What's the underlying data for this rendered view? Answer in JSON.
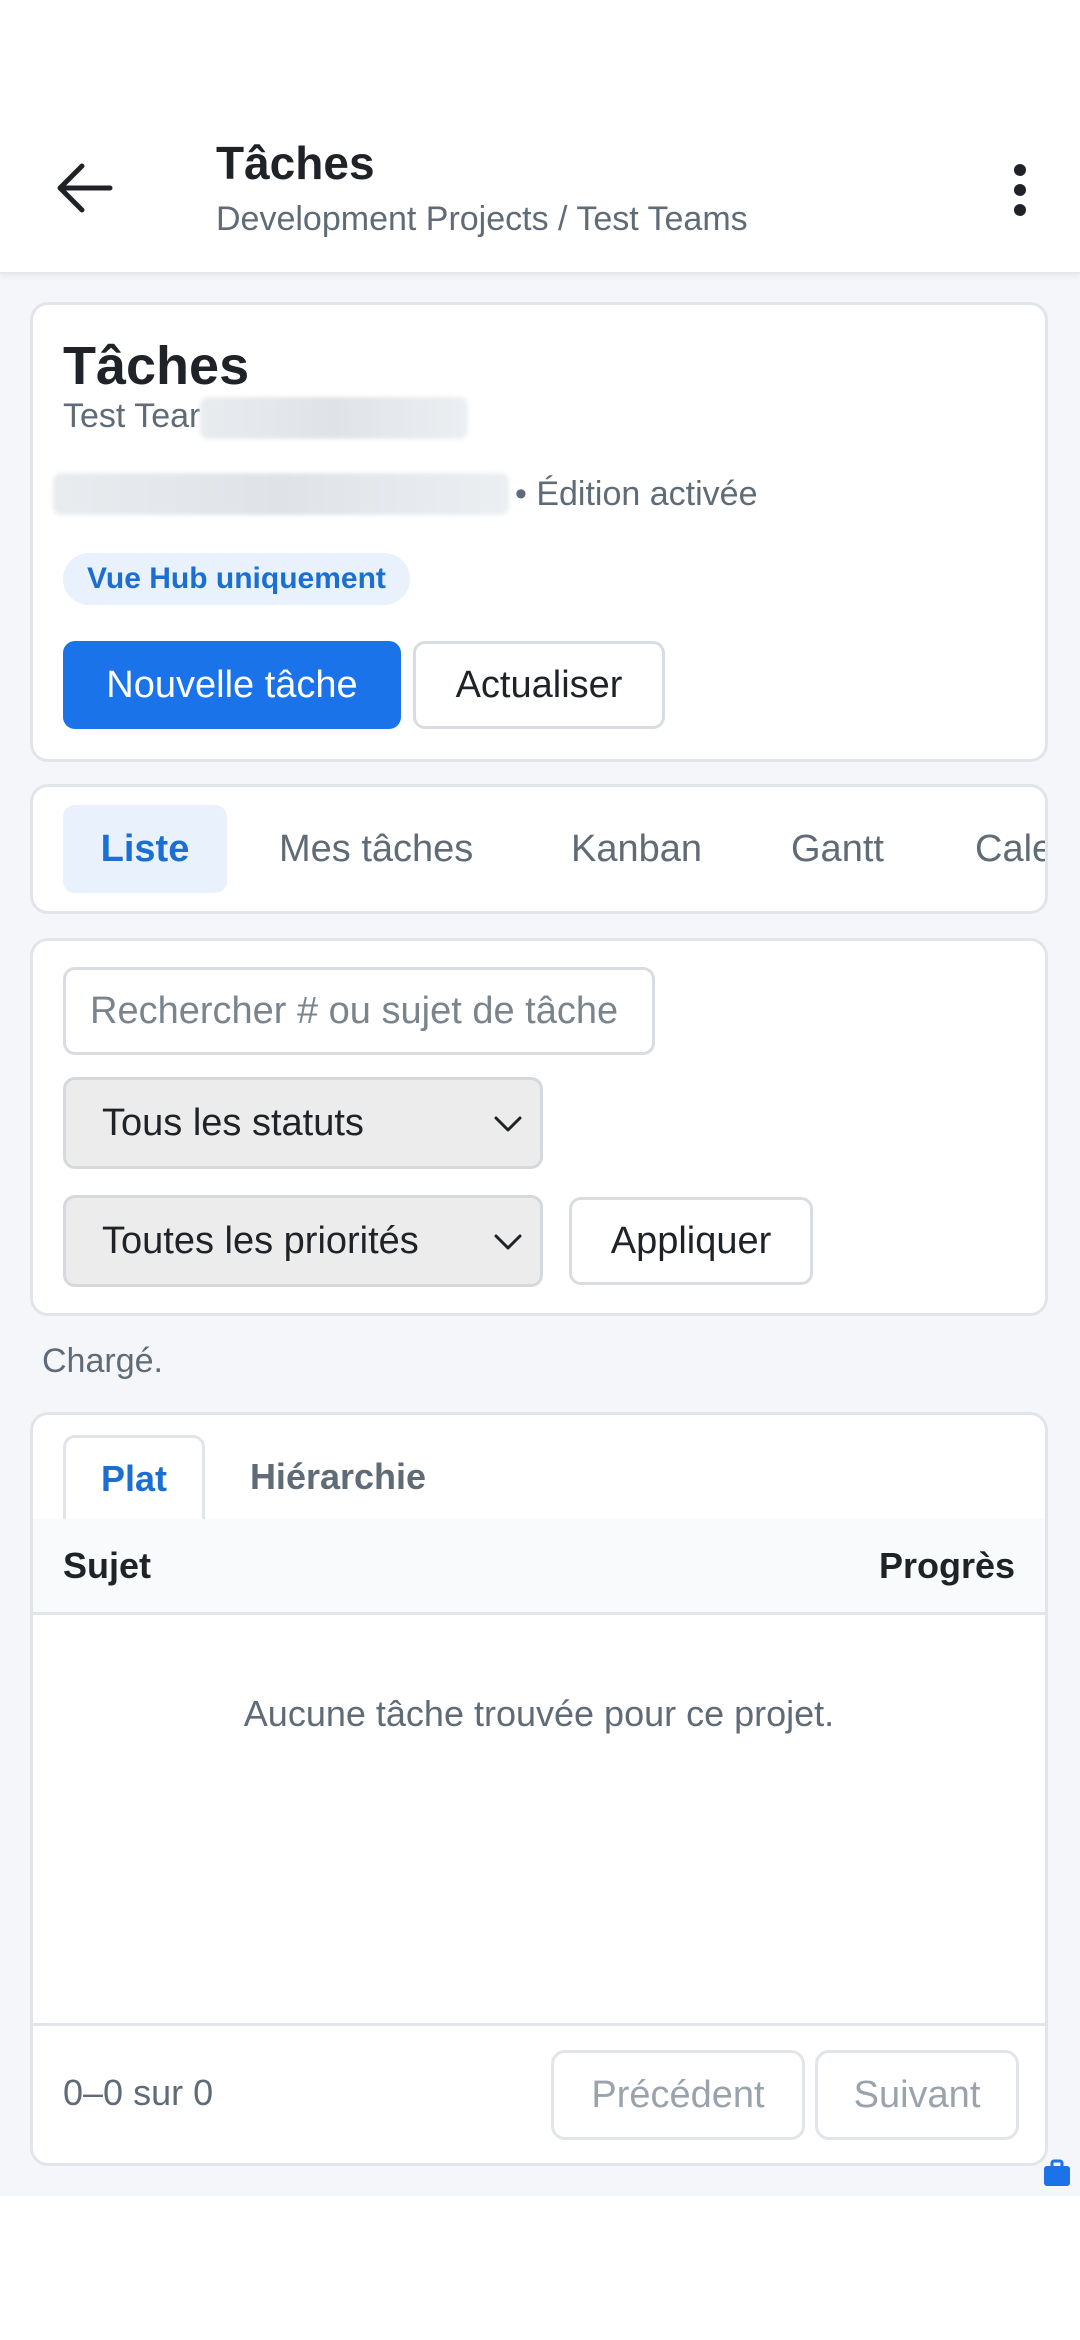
{
  "appbar": {
    "title": "Tâches",
    "subtitle": "Development Projects / Test Teams"
  },
  "header": {
    "title": "Tâches",
    "team_name": "Test Tear",
    "edit_status": "• Édition activée",
    "badge": "Vue Hub uniquement",
    "new_task_label": "Nouvelle tâche",
    "refresh_label": "Actualiser"
  },
  "views": {
    "tabs": [
      {
        "label": "Liste"
      },
      {
        "label": "Mes tâches"
      },
      {
        "label": "Kanban"
      },
      {
        "label": "Gantt"
      },
      {
        "label": "Cale"
      }
    ],
    "active": "Liste"
  },
  "filters": {
    "search_placeholder": "Rechercher # ou sujet de tâche",
    "status_selected": "Tous les statuts",
    "priority_selected": "Toutes les priorités",
    "apply_label": "Appliquer"
  },
  "status_text": "Chargé.",
  "table": {
    "subtabs": [
      {
        "label": "Plat"
      },
      {
        "label": "Hiérarchie"
      }
    ],
    "active_subtab": "Plat",
    "columns": {
      "subject": "Sujet",
      "progress": "Progrès"
    },
    "empty_message": "Aucune tâche trouvée pour ce projet.",
    "pagination": {
      "info": "0–0 sur 0",
      "prev_label": "Précédent",
      "next_label": "Suivant"
    }
  },
  "colors": {
    "accent": "#1a73e8",
    "badge_bg": "#e8f1fc",
    "badge_text": "#1b6fd1",
    "page_bg": "#f4f6f9"
  },
  "icons": {
    "back": "arrow-left-icon",
    "more": "more-vertical-icon",
    "chevron": "chevron-down-icon",
    "corner": "briefcase-icon"
  }
}
